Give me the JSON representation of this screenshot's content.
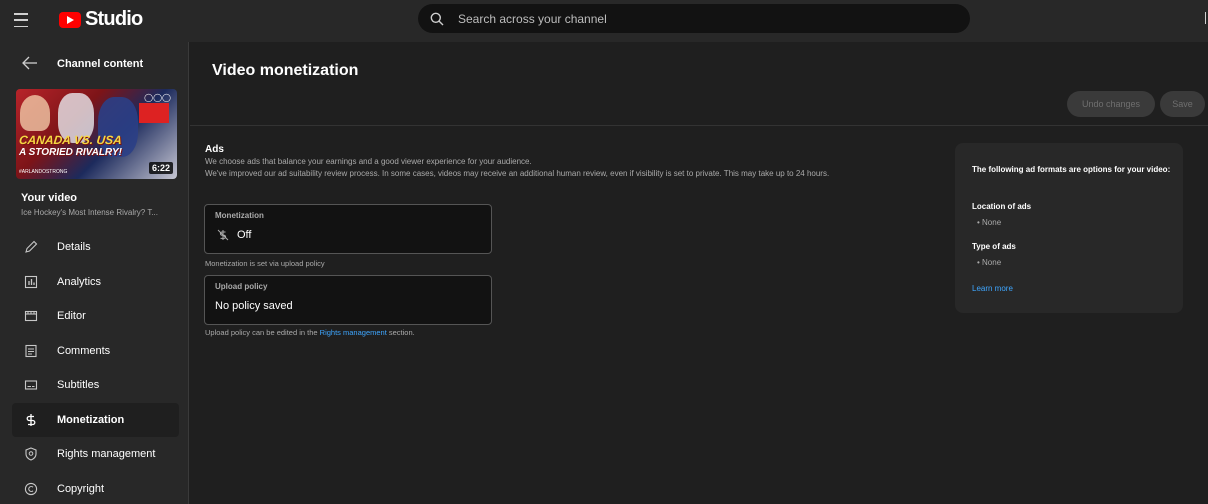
{
  "app": {
    "logo_text": "Studio",
    "brand_color": "#ff0000",
    "accent_link_color": "#3ea6ff"
  },
  "search": {
    "placeholder": "Search across your channel",
    "value": ""
  },
  "sidebar": {
    "back_label": "Channel content",
    "thumbnail": {
      "duration": "6:22",
      "headline_line1": "CANADA VS. USA",
      "headline_line2": "A STORIED RIVALRY!",
      "tag": "#ARLANDOSTRONG"
    },
    "your_video_label": "Your video",
    "video_title": "Ice Hockey's Most Intense Rivalry? T...",
    "items": [
      {
        "label": "Details",
        "icon": "pencil-icon"
      },
      {
        "label": "Analytics",
        "icon": "analytics-icon"
      },
      {
        "label": "Editor",
        "icon": "editor-icon"
      },
      {
        "label": "Comments",
        "icon": "comments-icon"
      },
      {
        "label": "Subtitles",
        "icon": "subtitles-icon"
      },
      {
        "label": "Monetization",
        "icon": "dollar-icon",
        "active": true
      },
      {
        "label": "Rights management",
        "icon": "rights-icon"
      },
      {
        "label": "Copyright",
        "icon": "copyright-icon"
      }
    ]
  },
  "main": {
    "title": "Video monetization",
    "buttons": {
      "undo": "Undo changes",
      "save": "Save"
    },
    "ads": {
      "title": "Ads",
      "description_line1": "We choose ads that balance your earnings and a good viewer experience for your audience.",
      "description_line2": "We've improved our ad suitability review process. In some cases, videos may receive an additional human review, even if visibility is set to private. This may take up to 24 hours."
    },
    "monetization_field": {
      "label": "Monetization",
      "value": "Off",
      "helper": "Monetization is set via upload policy"
    },
    "upload_policy_field": {
      "label": "Upload policy",
      "value": "No policy saved",
      "helper_prefix": "Upload policy can be edited in the ",
      "helper_link": "Rights management",
      "helper_suffix": " section."
    }
  },
  "info_card": {
    "heading": "The following ad formats are options for your video:",
    "location_label": "Location of ads",
    "location_value": "None",
    "type_label": "Type of ads",
    "type_value": "None",
    "learn_more": "Learn more"
  }
}
